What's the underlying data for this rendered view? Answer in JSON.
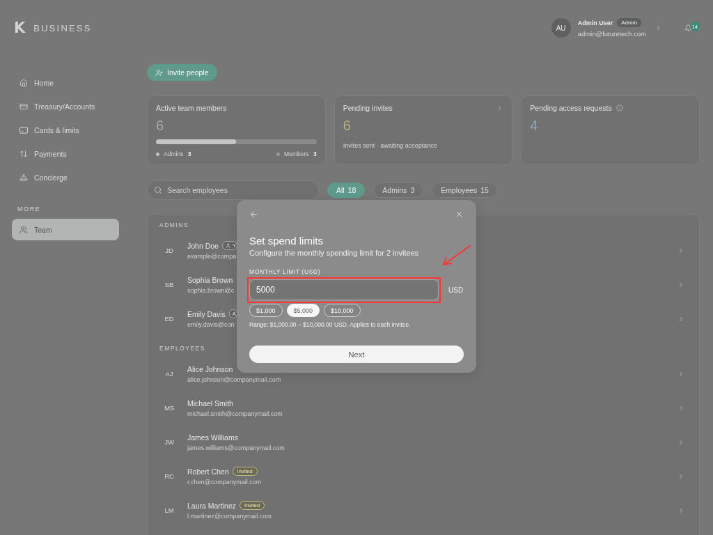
{
  "header": {
    "logo": "K",
    "brand": "BUSINESS",
    "user": {
      "initials": "AU",
      "name": "Admin User",
      "role": "Admin",
      "email": "admin@futuretech.com"
    },
    "notifications": "14"
  },
  "sidebar": {
    "items": [
      {
        "label": "Home",
        "selected": false
      },
      {
        "label": "Treasury/Accounts",
        "selected": false
      },
      {
        "label": "Cards & limits",
        "selected": false
      },
      {
        "label": "Payments",
        "selected": false
      },
      {
        "label": "Concierge",
        "selected": false
      }
    ],
    "section": "MORE",
    "section_items": [
      {
        "label": "Team",
        "selected": true
      }
    ]
  },
  "invite_button": "Invite people",
  "stats": [
    {
      "kind": "breakdown",
      "title": "Active team members",
      "value": "6",
      "color": "#aaaaaa",
      "level": 0.5,
      "legend": [
        {
          "label": "Admins",
          "count": "3",
          "color": "#c2c2c2"
        },
        {
          "label": "Members",
          "count": "3",
          "color": "#9b9b9b"
        }
      ]
    },
    {
      "kind": "link",
      "title": "Pending invites",
      "value": "6",
      "color": "#b8af88",
      "note": "Invites sent · awaiting acceptance"
    },
    {
      "kind": "info",
      "title": "Pending access requests",
      "value": "4",
      "color": "#8ea8bb"
    }
  ],
  "search": {
    "placeholder": "Search employees"
  },
  "tabs": [
    {
      "label": "All",
      "count": "18",
      "selected": true
    },
    {
      "label": "Admins",
      "count": "3",
      "selected": false
    },
    {
      "label": "Employees",
      "count": "15",
      "selected": false
    }
  ],
  "groups": [
    {
      "title": "ADMINS",
      "members": [
        {
          "initials": "JD",
          "name": "John Doe",
          "email": "example@compa",
          "badge": {
            "kind": "you",
            "label": "Y"
          }
        },
        {
          "initials": "SB",
          "name": "Sophia Brown",
          "email": "sophia.brown@c"
        },
        {
          "initials": "ED",
          "name": "Emily Davis",
          "email": "emily.davis@con",
          "badge": {
            "kind": "role",
            "label": "A"
          }
        }
      ]
    },
    {
      "title": "EMPLOYEES",
      "members": [
        {
          "initials": "AJ",
          "name": "Alice Johnson",
          "email": "alice.johnson@companymail.com"
        },
        {
          "initials": "MS",
          "name": "Michael Smith",
          "email": "michael.smith@companymail.com"
        },
        {
          "initials": "JW",
          "name": "James Williams",
          "email": "james.williams@companymail.com"
        },
        {
          "initials": "RC",
          "name": "Robert Chen",
          "email": "r.chen@companymail.com",
          "badge": {
            "kind": "invited",
            "label": "Invited"
          }
        },
        {
          "initials": "LM",
          "name": "Laura Martinez",
          "email": "l.martinez@companymail.com",
          "badge": {
            "kind": "invited",
            "label": "Invited"
          }
        }
      ]
    }
  ],
  "modal": {
    "title": "Set spend limits",
    "subtitle": "Configure the monthly spending limit for 2 invitees",
    "field_label": "MONTHLY LIMIT (USD)",
    "value": "5000",
    "suffix": "USD",
    "presets": [
      {
        "label": "$1,000",
        "selected": false
      },
      {
        "label": "$5,000",
        "selected": true
      },
      {
        "label": "$10,000",
        "selected": false
      }
    ],
    "hint": "Range: $1,000.00 – $10,000.00 USD. Applies to each invitee.",
    "button": "Next"
  },
  "annotation": {
    "highlight_frame": true,
    "pointer_arrow": true
  }
}
